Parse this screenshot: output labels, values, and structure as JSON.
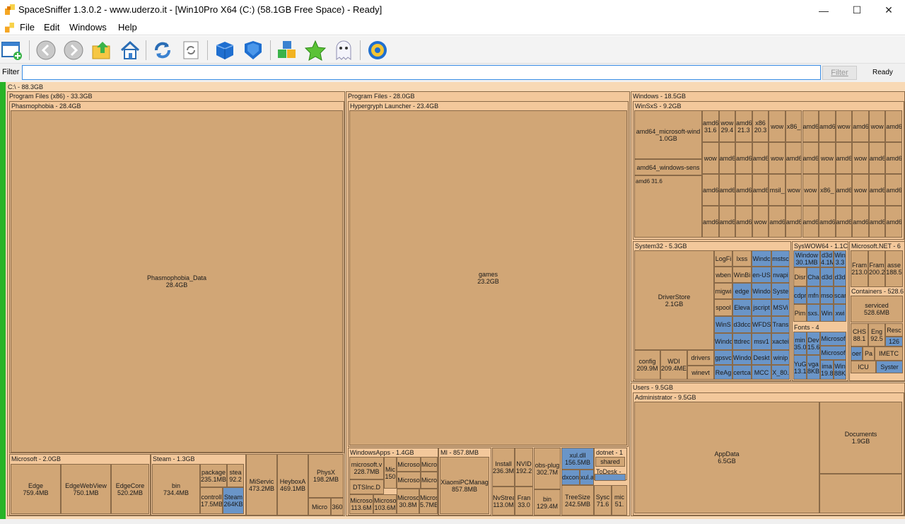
{
  "window": {
    "title": "SpaceSniffer 1.3.0.2 - www.uderzo.it - [Win10Pro X64 (C:) (58.1GB Free Space) - Ready]",
    "minimize_glyph": "—",
    "maximize_glyph": "☐",
    "close_glyph": "✕"
  },
  "menu": {
    "items": [
      "File",
      "Edit",
      "Windows",
      "Help"
    ],
    "mdi_min": "_",
    "mdi_restore": "▫",
    "mdi_close": "✕"
  },
  "toolbar": {
    "icons": [
      "new-scan-icon",
      "back-icon",
      "forward-icon",
      "up-folder-icon",
      "home-icon",
      "refresh-icon",
      "refresh-all-icon",
      "blue-box-icon",
      "blue-shield-icon",
      "cubes-icon",
      "star-icon",
      "ghost-icon",
      "settings-gear-icon"
    ]
  },
  "filter": {
    "label": "Filter",
    "value": "",
    "button": "Filter",
    "status": "Ready"
  },
  "treemap": {
    "root": "C:\\ - 88.3GB",
    "program_files_x86": "Program Files (x86) - 33.3GB",
    "phasmophobia": "Phasmophobia - 28.4GB",
    "phasmophobia_data": "Phasmophobia_Data\n28.4GB",
    "microsoft": "Microsoft - 2.0GB",
    "edge": "Edge\n759.4MB",
    "edgewebview": "EdgeWebView\n750.1MB",
    "edgecore": "EdgeCore\n520.2MB",
    "steam": "Steam - 1.3GB",
    "bin": "bin\n734.4MB",
    "package": "package\n235.1MB",
    "steamapps": "stea\n92.2",
    "controller": "controll\n17.5MB",
    "steam_blue": "Steam\n264KB",
    "miservice": "MiServic\n473.2MB",
    "heybox": "HeyboxA\n469.1MB",
    "physx": "PhysX\n198.2MB",
    "micro_small": "Micro",
    "n360": "360",
    "program_files": "Program Files - 28.0GB",
    "hypergryph": "Hypergryph Launcher - 23.4GB",
    "games": "games\n23.2GB",
    "windowsapps": "WindowsApps - 1.4GB",
    "ms_v": "microsoft.v\n228.7MB",
    "mic150": "Mic\n150",
    "dtsinc": "DTSInc.D",
    "microso_a": "Microso\n113.6M",
    "microso_b": "Microso\n103.6M",
    "micro_c": "Microso",
    "micro_d": "Micro",
    "micro_e": "Microso",
    "micro_f": "Micro",
    "micro_g": "Microso\n30.8M",
    "micro_h": "Micros\n5.7MB",
    "mi": "MI - 857.8MB",
    "xiaomi": "XiaomiPCManag\n857.8MB",
    "installer": "Install\n236.3M",
    "nvidia": "NVID\n192.2",
    "nvstream": "NvStrea\n113.0M",
    "frame": "Fran\n33.0",
    "obs": "obs-plug\n302.7M",
    "bin2": "bin\n129.4M",
    "xuldll": "xul.dll\n156.5MB",
    "dxcom": "dxcon",
    "xula": "xul.a",
    "treesize": "TreeSize\n242.5MB",
    "sysc": "Sysc\n71.6",
    "mic51": "mic\n51.",
    "dotnet": "dotnet - 1",
    "shared": "shared",
    "todesk": "ToDesk -",
    "windows": "Windows - 18.5GB",
    "winsxs": "WinSxS - 9.2GB",
    "amd64_wind": "amd64_microsoft-wind\n1.0GB",
    "amd64_sens": "amd64_windows-sens",
    "system32": "System32 - 5.3GB",
    "driverstore": "DriverStore\n2.1GB",
    "config": "config\n209.9M",
    "wdi": "WDI\n209.4ME",
    "drivers": "drivers",
    "winevt": "winevt",
    "syswow64": "SysWOW64 - 1.1C",
    "windows_s": "Window\n30.1MB",
    "d3d": "d3d\n4.1M",
    "win33": "Win\n3.3",
    "msnet": "Microsoft.NET - 6",
    "fram1": "Fram\n213.0",
    "fram2": "Fram\n200.2",
    "asse": "asse\n188.5",
    "containers": "Containers - 528.6",
    "serviced": "serviced\n528.6MB",
    "fonts": "Fonts - 4",
    "chs": "CHS\n88.1",
    "eng": "Eng\n92.5",
    "resc": "Resc",
    "r126": "126",
    "imetc": "IMETC",
    "icu": "ICU",
    "system_b": "Syster",
    "users": "Users - 9.5GB",
    "administrator": "Administrator - 9.5GB",
    "appdata": "AppData\n6.5GB",
    "documents": "Documents\n1.9GB",
    "logfi": "LogFi",
    "lxss": "lxss",
    "wbem": "wben",
    "winbi": "WinBi",
    "migwi": "migwi",
    "spool": "spool",
    "winsx2": "WinS",
    "windo2": "Windo",
    "gpsvc": "gpsvc",
    "rea": "ReAg",
    "edge2": "edge",
    "eleva": "Eleva",
    "d3dcc": "d3dcc",
    "ttdrec": "ttdrec",
    "windo3": "Windo",
    "certca": "certca",
    "windc": "Windc",
    "enus": "en-US",
    "windo4": "Windo",
    "jscript": "jscript",
    "wfds": "WFDS",
    "msv1": "msv1",
    "deskt": "Deskt",
    "mcc": "MCC",
    "mstsc": "mstsc",
    "nvap": "nvapi",
    "syste": "Syste",
    "msvi": "MSVi",
    "trans": "Trans",
    "xacte": "xactei",
    "winip": "winip",
    "x80": "X_80.",
    "disr": "Disr",
    "cha": "Cha",
    "d3d2": "d3d",
    "d3d3": "d3d",
    "cdpr": "cdpr",
    "mfn": "mfn",
    "mso": "mso",
    "scar": "scar",
    "pim": "Pim",
    "sxs": "sxs.",
    "win2": "Win",
    "xwi": "xwi",
    "mine": "min\n35.0",
    "dev": "Dev\n15.6",
    "yug": "YuG\n13.1",
    "vga": "vga\n8KB",
    "ima": "ima\n19.8",
    "win88": "Win\n88K",
    "microsoft_f1": "Microsof",
    "microsoft_f2": "Microsof",
    "oer": "oer",
    "pa": "Pa",
    "lxss_blank": ""
  },
  "winsxs_grid": {
    "cells": [
      "amd6\n31.6",
      "wow\n29.4",
      "amd6\n21.3",
      "x86\n20.3",
      "wow",
      "x86_",
      "amd6",
      "amd6",
      "wow",
      "amd6",
      "wow",
      "amd6",
      "wow",
      "amd6",
      "amd6",
      "amd6",
      "wow",
      "amd6",
      "amd6",
      "wow",
      "amd6",
      "wow",
      "amd6",
      "amd6",
      "amd6",
      "amd6",
      "amd6",
      "amd6",
      "msil_",
      "wow",
      "wow",
      "x86_",
      "amd6",
      "wow",
      "amd6",
      "amd6",
      "amd6",
      "amd6",
      "amd6",
      "wow",
      "amd6",
      "amd6",
      "amd6",
      "amd6",
      "amd6",
      "amd6",
      "amd6",
      "amd6"
    ]
  }
}
